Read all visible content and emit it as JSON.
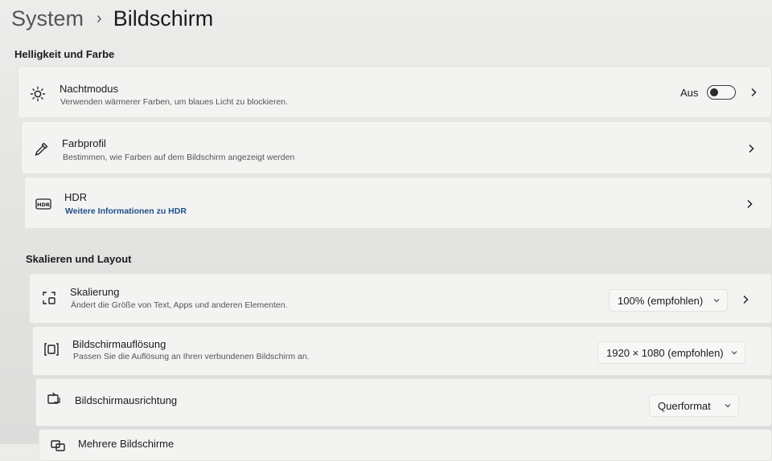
{
  "breadcrumb": {
    "parent": "System",
    "separator": "›",
    "current": "Bildschirm"
  },
  "sections": {
    "brightness": "Helligkeit und Farbe",
    "scaling": "Skalieren und Layout"
  },
  "night_mode": {
    "title": "Nachtmodus",
    "subtitle": "Verwenden wärmerer Farben, um blaues Licht zu blockieren.",
    "state_label": "Aus",
    "enabled": false,
    "icon": "brightness-icon"
  },
  "color_profile": {
    "title": "Farbprofil",
    "subtitle": "Bestimmen, wie Farben auf dem Bildschirm angezeigt werden",
    "icon": "color-picker-icon"
  },
  "hdr": {
    "title": "HDR",
    "link": "Weitere Informationen zu HDR",
    "icon_text": "HDR",
    "icon": "hdr-icon"
  },
  "scaling": {
    "title": "Skalierung",
    "subtitle": "Ändert die Größe von Text, Apps und anderen Elementen.",
    "value": "100% (empfohlen)",
    "icon": "scale-icon"
  },
  "resolution": {
    "title": "Bildschirmauflösung",
    "subtitle": "Passen Sie die Auflösung an Ihren verbundenen Bildschirm an.",
    "value": "1920 × 1080 (empfohlen)",
    "icon": "resolution-icon"
  },
  "orientation": {
    "title": "Bildschirmausrichtung",
    "value": "Querformat",
    "icon": "orientation-icon"
  },
  "multiple_displays": {
    "title": "Mehrere Bildschirme",
    "icon": "multiple-displays-icon"
  },
  "colors": {
    "link": "#1f4f86",
    "toggle_off_border": "#3a3a3a",
    "card_bg": "#f3f3f2"
  }
}
